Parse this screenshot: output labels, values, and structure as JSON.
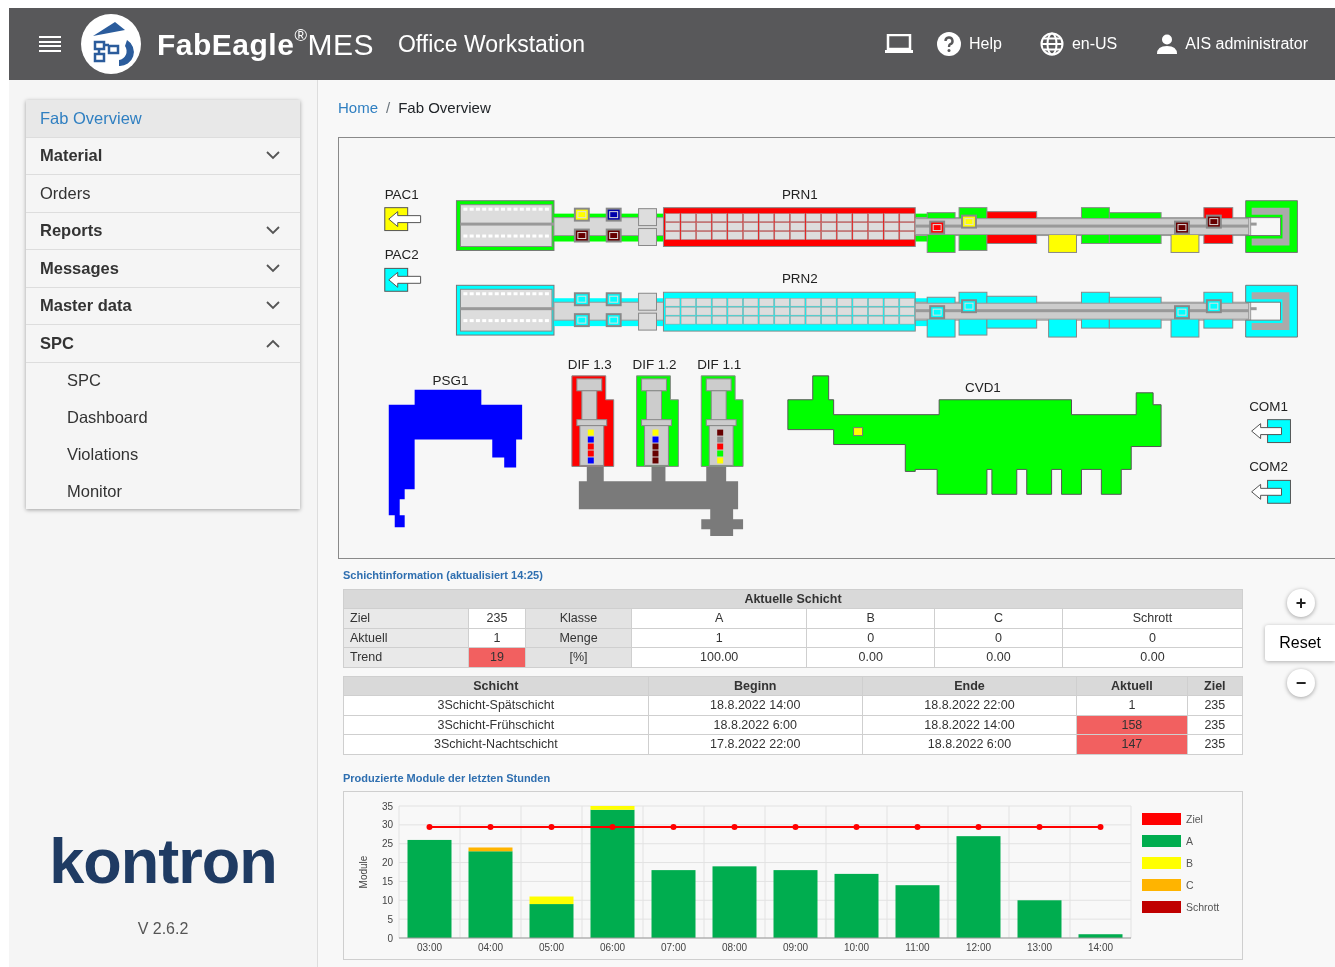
{
  "header": {
    "brand": "**FabEagle**$^{®}$MES",
    "subtitle": "Office Workstation",
    "help": "Help",
    "language": "en-US",
    "user": "AIS administrator"
  },
  "sidebar": {
    "items": [
      {
        "label": "Fab Overview",
        "kind": "link",
        "selected": true
      },
      {
        "label": "Material",
        "kind": "group",
        "selected": false,
        "expanded": false
      },
      {
        "label": "Orders",
        "kind": "link",
        "selected": false
      },
      {
        "label": "Reports",
        "kind": "group",
        "selected": false,
        "expanded": false
      },
      {
        "label": "Messages",
        "kind": "group",
        "selected": false,
        "expanded": false
      },
      {
        "label": "Master data",
        "kind": "group",
        "selected": false,
        "expanded": false
      },
      {
        "label": "SPC",
        "kind": "group",
        "selected": false,
        "expanded": true,
        "children": [
          {
            "label": "SPC",
            "selected": false
          },
          {
            "label": "Dashboard",
            "selected": false
          },
          {
            "label": "Violations",
            "selected": false
          },
          {
            "label": "Monitor",
            "selected": false
          }
        ]
      }
    ],
    "logo": "kontron",
    "version": "V 2.6.2"
  },
  "breadcrumb": {
    "separator": "/",
    "items": [
      {
        "label": "Home",
        "kind": "link"
      },
      {
        "label": "Fab Overview",
        "kind": "current"
      }
    ]
  },
  "layout": {
    "machines": [
      {
        "name": "PAC1",
        "kind": "inport",
        "color": "#ffff00"
      },
      {
        "name": "PAC2",
        "kind": "inport",
        "color": "#00ffff"
      },
      {
        "name": "PRN1",
        "kind": "line",
        "color": "#ff0000",
        "modules": [
          {
            "color": "#00ff00"
          },
          {
            "color": "#00ff00"
          },
          {
            "color": "#00ff00"
          },
          {
            "color": "#ff0000"
          },
          {
            "color": "#ffff00"
          },
          {
            "color": "#00ff00"
          },
          {
            "color": "#00ff00"
          },
          {
            "color": "#ffff00"
          },
          {
            "color": "#ff0000"
          },
          {
            "color": "#00ff00"
          }
        ]
      },
      {
        "name": "PRN2",
        "kind": "line",
        "color": "#00ffff",
        "modules": [
          {
            "color": "#00ffff"
          },
          {
            "color": "#00ffff"
          },
          {
            "color": "#00ffff"
          },
          {
            "color": "#00ffff"
          },
          {
            "color": "#00ffff"
          },
          {
            "color": "#00ffff"
          },
          {
            "color": "#00ffff"
          },
          {
            "color": "#00ffff"
          },
          {
            "color": "#00ffff"
          },
          {
            "color": "#00ffff"
          }
        ]
      },
      {
        "name": "PSG1",
        "kind": "psg",
        "color": "#0000ff"
      },
      {
        "name": "DIF 1.3",
        "kind": "furnace",
        "color": "#ff0000"
      },
      {
        "name": "DIF 1.2",
        "kind": "furnace",
        "color": "#00ff00"
      },
      {
        "name": "DIF 1.1",
        "kind": "furnace",
        "color": "#00ff00"
      },
      {
        "name": "CVD1",
        "kind": "cvd",
        "color": "#00ff00"
      },
      {
        "name": "COM1",
        "kind": "outport",
        "color": "#00ffff"
      },
      {
        "name": "COM2",
        "kind": "outport",
        "color": "#00ffff"
      }
    ]
  },
  "zoom": {
    "reset": "Reset",
    "plus": "+",
    "minus": "−"
  },
  "shift_info": {
    "title": "Schichtinformation (aktualisiert 14:25)",
    "current": {
      "title": "Aktuelle Schicht",
      "rows": [
        {
          "label": "Ziel",
          "value": "235",
          "alert": false,
          "label2": "Klasse",
          "cells": [
            "A",
            "B",
            "C",
            "Schrott"
          ]
        },
        {
          "label": "Aktuell",
          "value": "1",
          "alert": false,
          "label2": "Menge",
          "cells": [
            "1",
            "0",
            "0",
            "0"
          ]
        },
        {
          "label": "Trend",
          "value": "19",
          "alert": true,
          "label2": "[%]",
          "cells": [
            "100.00",
            "0.00",
            "0.00",
            "0.00"
          ]
        }
      ]
    },
    "shifts": {
      "columns": [
        "Schicht",
        "Beginn",
        "Ende",
        "Aktuell",
        "Ziel"
      ],
      "rows": [
        {
          "cells": [
            "3Schicht-Spätschicht",
            "18.8.2022 14:00",
            "18.8.2022 22:00",
            "1",
            "235"
          ],
          "alert": false
        },
        {
          "cells": [
            "3Schicht-Frühschicht",
            "18.8.2022 6:00",
            "18.8.2022 14:00",
            "158",
            "235"
          ],
          "alert": true
        },
        {
          "cells": [
            "3Schicht-Nachtschicht",
            "17.8.2022 22:00",
            "18.8.2022 6:00",
            "147",
            "235"
          ],
          "alert": true
        }
      ]
    }
  },
  "production": {
    "title": "Produzierte Module der letzten Stunden",
    "chart_data": {
      "type": "bar",
      "stacked": true,
      "grid": true,
      "legend": true,
      "ylabel": "Module",
      "categories": [
        "03:00",
        "04:00",
        "05:00",
        "06:00",
        "07:00",
        "08:00",
        "09:00",
        "10:00",
        "11:00",
        "12:00",
        "13:00",
        "14:00"
      ],
      "ylim": [
        0,
        35
      ],
      "yticks": [
        {
          "value": 0,
          "label": "0"
        },
        5,
        10,
        15,
        20,
        25,
        30,
        35
      ],
      "series": [
        {
          "name": "Ziel",
          "color": "#ff0000",
          "type": "line",
          "marker": "circle",
          "values": [
            29.4,
            29.4,
            29.4,
            29.4,
            29.4,
            29.4,
            29.4,
            29.4,
            29.4,
            29.4,
            29.4,
            29.4
          ]
        },
        {
          "name": "A",
          "color": "#00ad4f",
          "values": [
            26,
            23,
            9,
            34,
            18,
            19,
            18,
            17,
            14,
            27,
            10,
            1
          ]
        },
        {
          "name": "B",
          "color": "#ffff00",
          "values": [
            0,
            0,
            2,
            1,
            0,
            0,
            0,
            0,
            0,
            0,
            0,
            0
          ]
        },
        {
          "name": "C",
          "color": "#ffb400",
          "values": [
            0,
            1,
            0,
            0,
            0,
            0,
            0,
            0,
            0,
            0,
            0,
            0
          ]
        },
        {
          "name": "Schrott",
          "color": "#c00000",
          "values": [
            0,
            0,
            0,
            0,
            0,
            0,
            0,
            0,
            0,
            0,
            0,
            0
          ]
        }
      ]
    }
  }
}
